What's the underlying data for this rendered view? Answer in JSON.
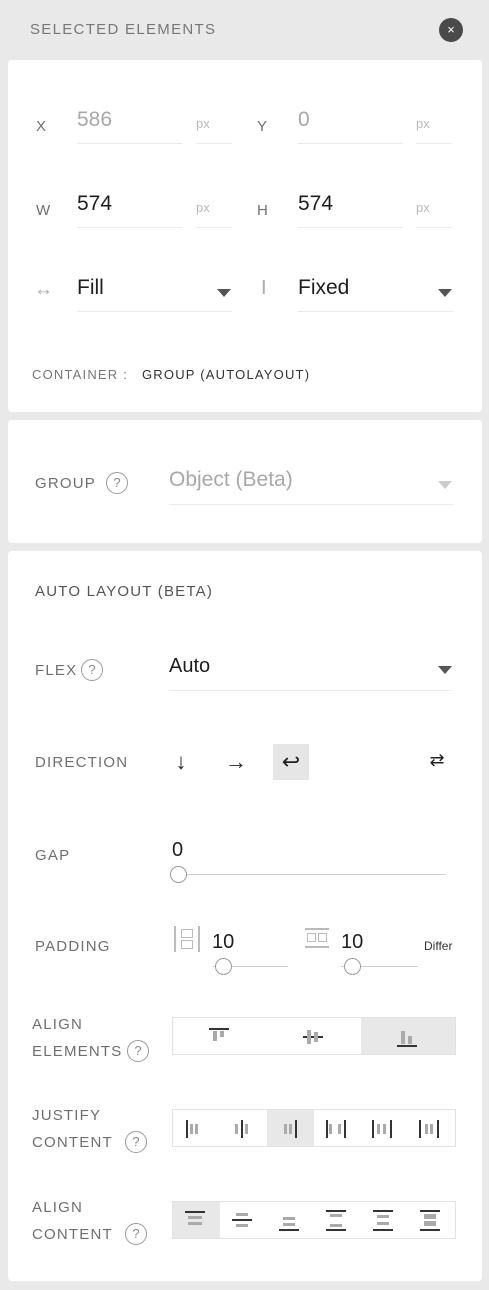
{
  "header": {
    "title": "SELECTED ELEMENTS",
    "close_icon": "×"
  },
  "geometry": {
    "x_label": "X",
    "x_value": "586",
    "x_unit": "px",
    "y_label": "Y",
    "y_value": "0",
    "y_unit": "px",
    "w_label": "W",
    "w_value": "574",
    "w_unit": "px",
    "h_label": "H",
    "h_value": "574",
    "h_unit": "px",
    "hsize_icon": "↔",
    "hsize_value": "Fill",
    "vsize_icon": "I",
    "vsize_value": "Fixed",
    "container_label": "CONTAINER :",
    "container_value": "GROUP (AUTOLAYOUT)"
  },
  "group": {
    "label": "GROUP",
    "help": "?",
    "value": "Object (Beta)"
  },
  "autolayout": {
    "title": "AUTO LAYOUT (BETA)",
    "flex_label": "FLEX",
    "flex_help": "?",
    "flex_value": "Auto",
    "direction_label": "DIRECTION",
    "direction_icons": [
      "↓",
      "→",
      "↩",
      "⇄"
    ],
    "direction_active": 2,
    "gap_label": "GAP",
    "gap_value": "0",
    "padding_label": "PADDING",
    "padding_h_value": "10",
    "padding_v_value": "10",
    "padding_mode": "Differ",
    "align_elements_label_1": "ALIGN",
    "align_elements_label_2": "ELEMENTS",
    "align_elements_help": "?",
    "justify_label_1": "JUSTIFY",
    "justify_label_2": "CONTENT",
    "justify_help": "?",
    "align_content_label_1": "ALIGN",
    "align_content_label_2": "CONTENT",
    "align_content_help": "?"
  }
}
